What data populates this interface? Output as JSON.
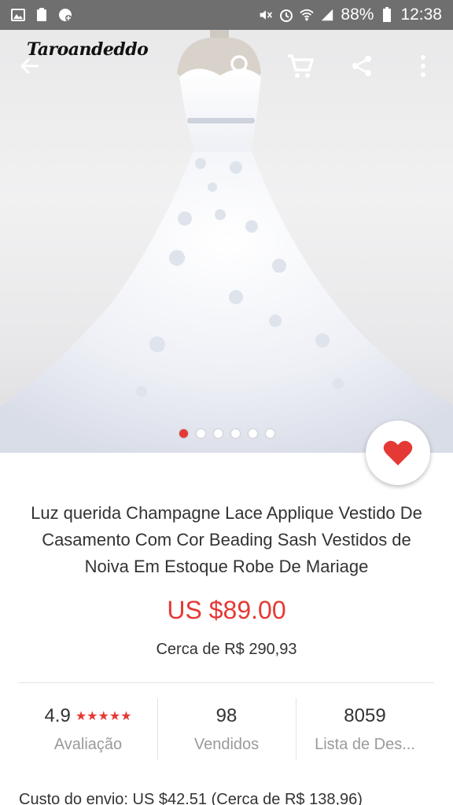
{
  "status_bar": {
    "battery": "88%",
    "time": "12:38"
  },
  "brand": "Taroandeddo",
  "icons": {
    "back": "arrow-back-icon",
    "search": "search-icon",
    "cart": "cart-icon",
    "share": "share-icon",
    "more": "more-vert-icon",
    "wishlist": "heart-icon"
  },
  "carousel": {
    "count": 6,
    "active_index": 0
  },
  "product": {
    "title": "Luz querida Champagne Lace Applique Vestido De Casamento Com Cor Beading Sash Vestidos de Noiva Em Estoque Robe De Mariage",
    "price": "US $89.00",
    "approx_price": "Cerca de R$ 290,93"
  },
  "stats": [
    {
      "value": "4.9",
      "stars": "★★★★★",
      "label": "Avaliação"
    },
    {
      "value": "98",
      "label": "Vendidos"
    },
    {
      "value": "8059",
      "label": "Lista de Des..."
    }
  ],
  "shipping": "Custo do envio: US $42.51 (Cerca de R$ 138,96)",
  "colors": {
    "accent": "#e53935",
    "status_bar": "#6f6f6f"
  }
}
